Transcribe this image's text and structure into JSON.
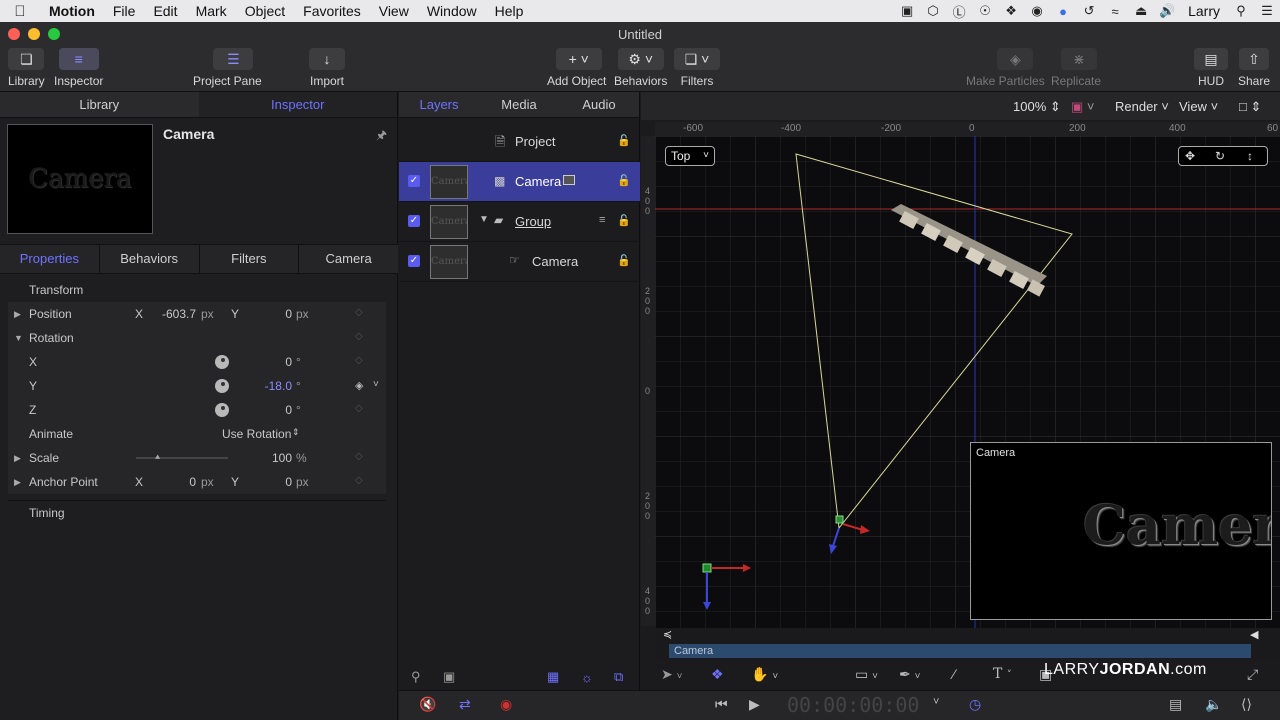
{
  "menubar": {
    "app": "Motion",
    "items": [
      "File",
      "Edit",
      "Mark",
      "Object",
      "Favorites",
      "View",
      "Window",
      "Help"
    ],
    "user": "Larry"
  },
  "window": {
    "title": "Untitled"
  },
  "toolbar": {
    "library": "Library",
    "inspector": "Inspector",
    "project_pane": "Project Pane",
    "import": "Import",
    "add_object": "Add Object",
    "behaviors": "Behaviors",
    "filters": "Filters",
    "make_particles": "Make Particles",
    "replicate": "Replicate",
    "hud": "HUD",
    "share": "Share"
  },
  "left": {
    "tabs": [
      "Library",
      "Inspector"
    ],
    "preview_text": "Camera",
    "object_name": "Camera",
    "subtabs": [
      "Properties",
      "Behaviors",
      "Filters",
      "Camera"
    ],
    "transform": "Transform",
    "position": {
      "label": "Position",
      "x_label": "X",
      "x": "-603.7",
      "x_unit": "px",
      "y_label": "Y",
      "y": "0",
      "y_unit": "px"
    },
    "rotation": {
      "label": "Rotation",
      "x_label": "X",
      "x": "0",
      "y_label": "Y",
      "y": "-18.0",
      "z_label": "Z",
      "z": "0",
      "unit": "°"
    },
    "animate": {
      "label": "Animate",
      "value": "Use Rotation"
    },
    "scale": {
      "label": "Scale",
      "value": "100",
      "unit": "%"
    },
    "anchor": {
      "label": "Anchor Point",
      "x_label": "X",
      "x": "0",
      "x_unit": "px",
      "y_label": "Y",
      "y": "0",
      "y_unit": "px"
    },
    "timing": "Timing"
  },
  "layers": {
    "tabs": [
      "Layers",
      "Media",
      "Audio"
    ],
    "project": "Project",
    "rows": [
      {
        "name": "Camera",
        "thumb": "Camera"
      },
      {
        "name": "Group",
        "thumb": "Camera"
      },
      {
        "name": "Camera",
        "thumb": "Camera"
      }
    ]
  },
  "canvas": {
    "zoom": "100%",
    "render": "Render",
    "view": "View",
    "camera_view": "Top",
    "ruler_ticks": [
      "-600",
      "-400",
      "-200",
      "0",
      "200",
      "400",
      "60"
    ],
    "vruler_marks": [
      "4\n0\n0",
      "2\n0\n0",
      "0",
      "2\n0\n0",
      "4\n0\n0"
    ],
    "inset_title": "Camera",
    "inset_text": "Camera",
    "timeline_label": "Camera"
  },
  "transport": {
    "timecode": "00:00:00:00"
  },
  "watermark": {
    "a": "LARRY",
    "b": "JORDAN",
    "c": ".com"
  }
}
